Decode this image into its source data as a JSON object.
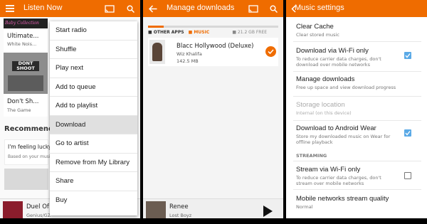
{
  "panel1": {
    "title": "Listen Now",
    "tiles": [
      {
        "title": "Ultimate...",
        "subtitle": "White Nois...",
        "art_text": "Baby Collection"
      },
      {
        "title": "Don't Sh...",
        "subtitle": "The Game",
        "art_text": "DONT SHOOT"
      }
    ],
    "menu_items": [
      "Start radio",
      "Shuffle",
      "Play next",
      "Add to queue",
      "Add to playlist",
      "Download",
      "Go to artist",
      "Remove from My Library",
      "Share",
      "Buy"
    ],
    "active_menu_item": "Download",
    "section_title": "Recommend",
    "card_title": "I'm feeling lucky",
    "card_subtitle": "Based on your music",
    "now_playing_title": "Duel Of T",
    "now_playing_artist": "Genius/GZ"
  },
  "panel2": {
    "title": "Manage downloads",
    "tab_other": "OTHER APPS",
    "tab_music": "MUSIC",
    "free_space": "21.2 GB FREE",
    "download_item": {
      "title": "Blacc Hollywood (Deluxe)",
      "artist": "Wiz Khalifa",
      "size": "142.5 MB"
    },
    "storage_used_fraction": 0.12,
    "now_playing_title": "Renee",
    "now_playing_artist": "Lost Boyz"
  },
  "panel3": {
    "title": "Music settings",
    "settings": [
      {
        "title": "Clear Cache",
        "subtitle": "Clear stored music"
      },
      {
        "title": "Download via Wi-Fi only",
        "subtitle": "To reduce carrier data charges, don't download over mobile networks",
        "checked": true
      },
      {
        "title": "Manage downloads",
        "subtitle": "Free up space and view download progress"
      },
      {
        "title": "Storage location",
        "subtitle": "Internal (on this device)",
        "disabled": true
      },
      {
        "title": "Download to Android Wear",
        "subtitle": "Store my downloaded music on Wear for offline playback",
        "checked": true
      }
    ],
    "section_streaming": "STREAMING",
    "streaming_settings": [
      {
        "title": "Stream via Wi-Fi only",
        "subtitle": "To reduce carrier data charges, don't stream over mobile networks",
        "checked": false
      },
      {
        "title": "Mobile networks stream quality",
        "subtitle": "Normal"
      }
    ]
  },
  "colors": {
    "accent": "#ef6c00",
    "checkbox": "#5aa9e6"
  }
}
